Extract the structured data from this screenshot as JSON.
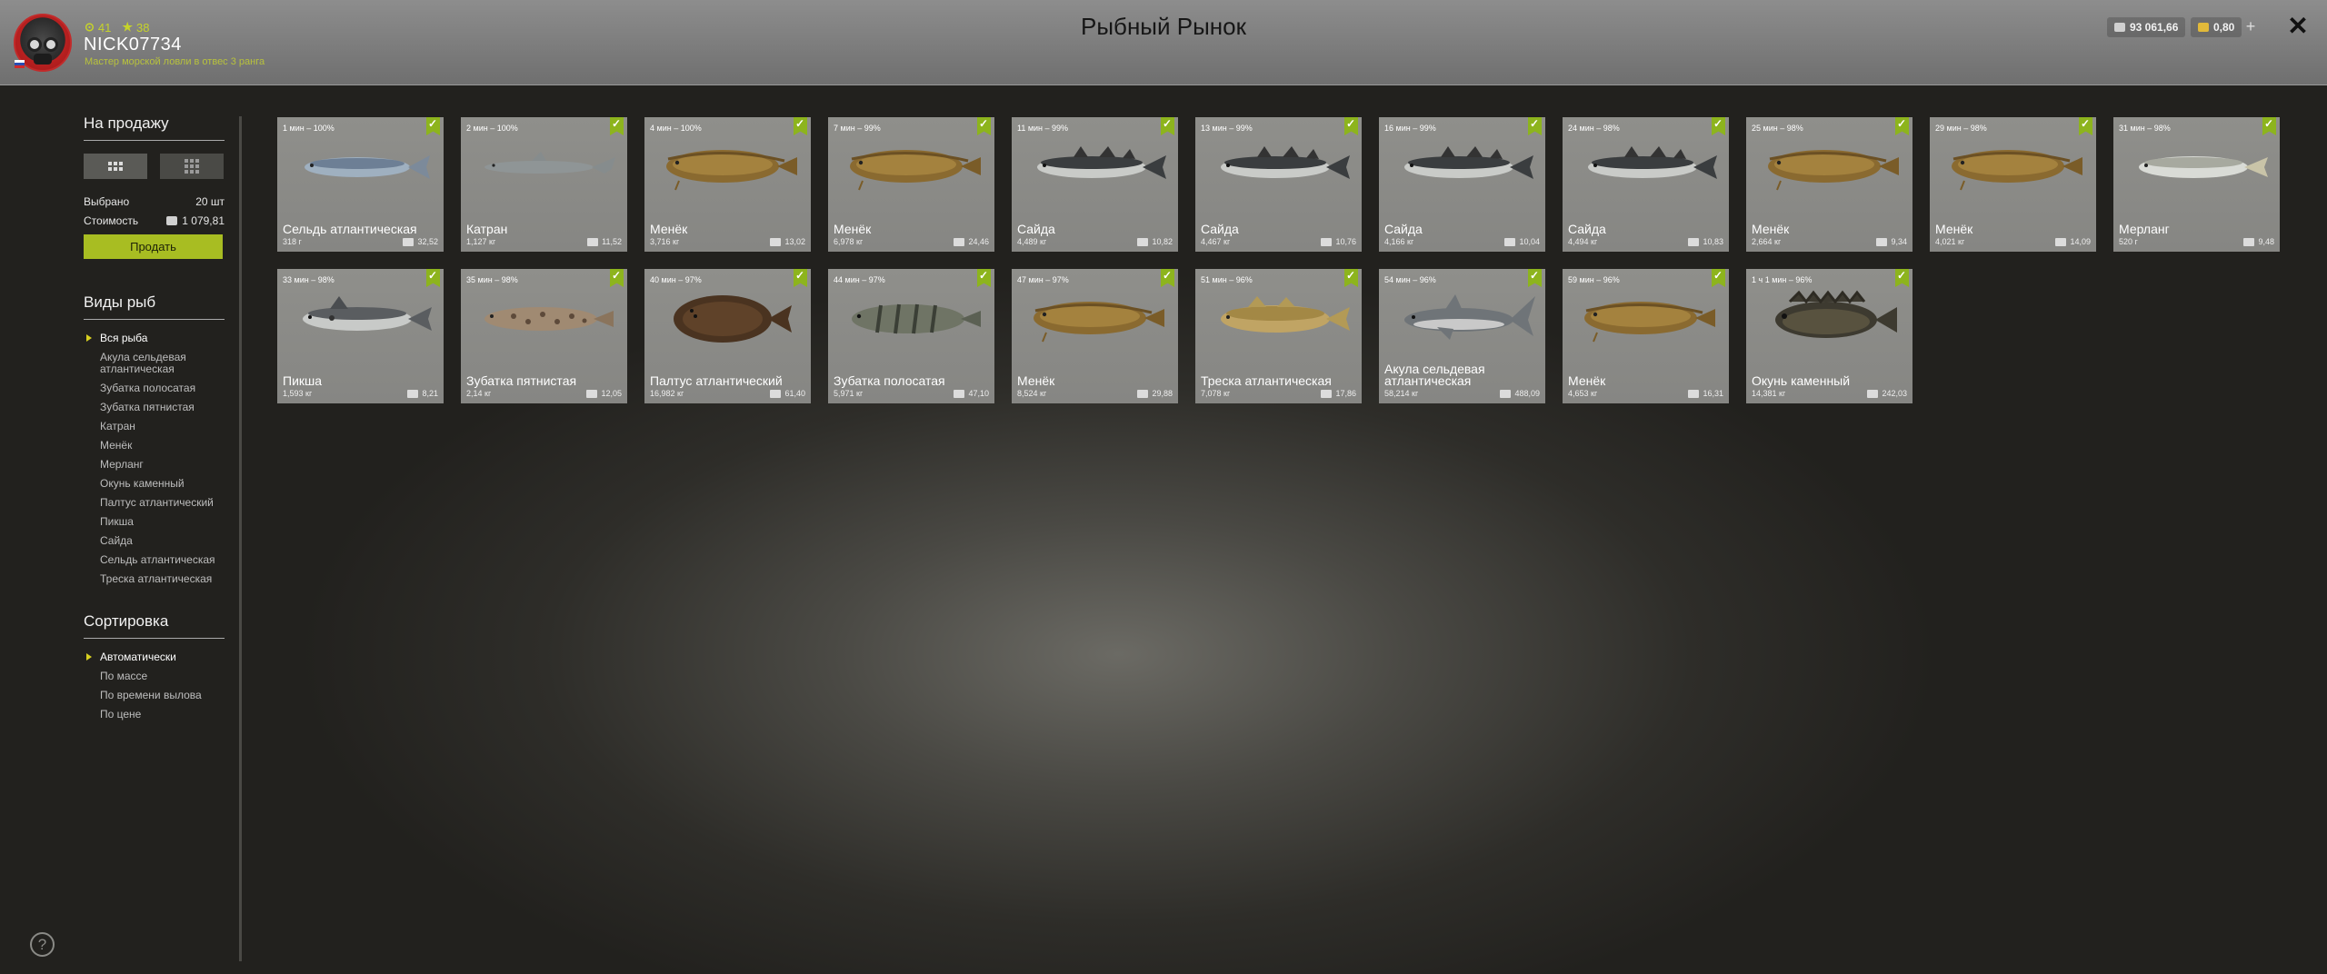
{
  "header": {
    "title": "Рыбный Рынок",
    "stat_a": "41",
    "stat_b": "38",
    "username": "NICK07734",
    "rank": "Мастер морской ловли в отвес 3 ранга",
    "silver": "93 061,66",
    "gold": "0,80",
    "plus": "+",
    "close": "✕"
  },
  "sidebar": {
    "sale_title": "На продажу",
    "selected_label": "Выбрано",
    "selected_value": "20 шт",
    "cost_label": "Стоимость",
    "cost_value": "1 079,81",
    "sell_label": "Продать",
    "types_title": "Виды рыб",
    "types": [
      "Вся рыба",
      "Акула сельдевая атлантическая",
      "Зубатка полосатая",
      "Зубатка пятнистая",
      "Катран",
      "Менёк",
      "Мерланг",
      "Окунь каменный",
      "Палтус атлантический",
      "Пикша",
      "Сайда",
      "Сельдь атлантическая",
      "Треска атлантическая"
    ],
    "sort_title": "Сортировка",
    "sorts": [
      "Автоматически",
      "По массе",
      "По времени вылова",
      "По цене"
    ],
    "help": "?"
  },
  "fish": [
    {
      "time": "1 мин – 100%",
      "name": "Сельдь атлантическая",
      "mass": "318 г",
      "price": "32,52",
      "kind": "herring"
    },
    {
      "time": "2 мин – 100%",
      "name": "Катран",
      "mass": "1,127 кг",
      "price": "11,52",
      "kind": "shark-small"
    },
    {
      "time": "4 мин – 100%",
      "name": "Менёк",
      "mass": "3,716 кг",
      "price": "13,02",
      "kind": "cusk"
    },
    {
      "time": "7 мин – 99%",
      "name": "Менёк",
      "mass": "6,978 кг",
      "price": "24,46",
      "kind": "cusk"
    },
    {
      "time": "11 мин – 99%",
      "name": "Сайда",
      "mass": "4,489 кг",
      "price": "10,82",
      "kind": "pollock"
    },
    {
      "time": "13 мин – 99%",
      "name": "Сайда",
      "mass": "4,467 кг",
      "price": "10,76",
      "kind": "pollock"
    },
    {
      "time": "16 мин – 99%",
      "name": "Сайда",
      "mass": "4,166 кг",
      "price": "10,04",
      "kind": "pollock"
    },
    {
      "time": "24 мин – 98%",
      "name": "Сайда",
      "mass": "4,494 кг",
      "price": "10,83",
      "kind": "pollock"
    },
    {
      "time": "25 мин – 98%",
      "name": "Менёк",
      "mass": "2,664 кг",
      "price": "9,34",
      "kind": "cusk"
    },
    {
      "time": "29 мин – 98%",
      "name": "Менёк",
      "mass": "4,021 кг",
      "price": "14,09",
      "kind": "cusk"
    },
    {
      "time": "31 мин – 98%",
      "name": "Мерланг",
      "mass": "520 г",
      "price": "9,48",
      "kind": "whiting"
    },
    {
      "time": "33 мин – 98%",
      "name": "Пикша",
      "mass": "1,593 кг",
      "price": "8,21",
      "kind": "haddock"
    },
    {
      "time": "35 мин – 98%",
      "name": "Зубатка пятнистая",
      "mass": "2,14 кг",
      "price": "12,05",
      "kind": "wolffish-spotted"
    },
    {
      "time": "40 мин – 97%",
      "name": "Палтус атлантический",
      "mass": "16,982 кг",
      "price": "61,40",
      "kind": "halibut"
    },
    {
      "time": "44 мин – 97%",
      "name": "Зубатка полосатая",
      "mass": "5,971 кг",
      "price": "47,10",
      "kind": "wolffish-striped"
    },
    {
      "time": "47 мин – 97%",
      "name": "Менёк",
      "mass": "8,524 кг",
      "price": "29,88",
      "kind": "cusk"
    },
    {
      "time": "51 мин – 96%",
      "name": "Треска атлантическая",
      "mass": "7,078 кг",
      "price": "17,86",
      "kind": "cod"
    },
    {
      "time": "54 мин – 96%",
      "name": "Акула сельдевая атлантическая",
      "mass": "58,214 кг",
      "price": "488,09",
      "kind": "porbeagle"
    },
    {
      "time": "59 мин – 96%",
      "name": "Менёк",
      "mass": "4,653 кг",
      "price": "16,31",
      "kind": "cusk"
    },
    {
      "time": "1 ч 1 мин – 96%",
      "name": "Окунь каменный",
      "mass": "14,381 кг",
      "price": "242,03",
      "kind": "rockfish"
    }
  ]
}
